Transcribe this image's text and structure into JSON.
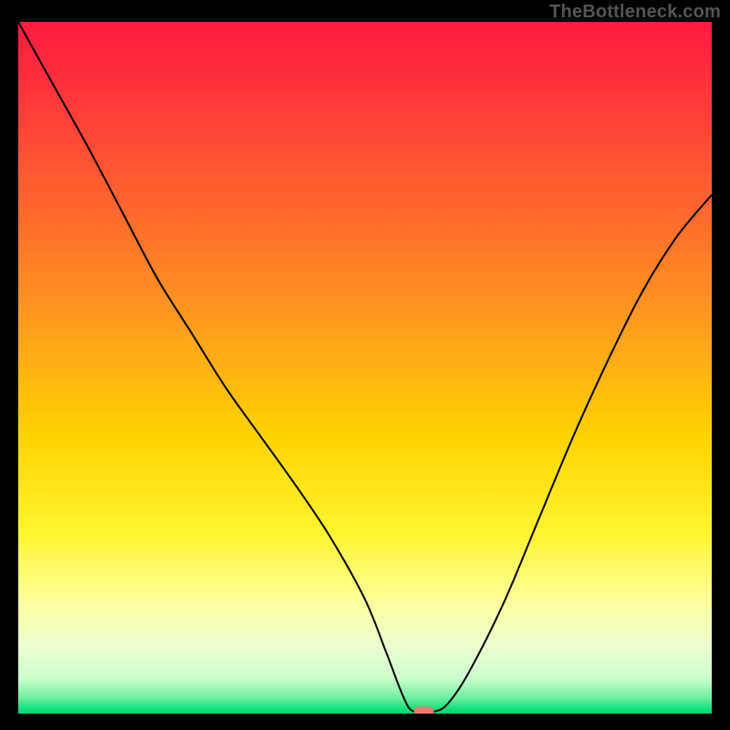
{
  "watermark": "TheBottleneck.com",
  "chart_data": {
    "type": "line",
    "title": "",
    "xlabel": "",
    "ylabel": "",
    "xlim": [
      0,
      100
    ],
    "ylim": [
      0,
      100
    ],
    "background_gradient": {
      "stops": [
        {
          "offset": 0.0,
          "color": "#ff1a40"
        },
        {
          "offset": 0.12,
          "color": "#ff3a3a"
        },
        {
          "offset": 0.28,
          "color": "#ff6a2d"
        },
        {
          "offset": 0.44,
          "color": "#ff9d1e"
        },
        {
          "offset": 0.6,
          "color": "#ffd400"
        },
        {
          "offset": 0.74,
          "color": "#fff531"
        },
        {
          "offset": 0.84,
          "color": "#fdff9e"
        },
        {
          "offset": 0.9,
          "color": "#eeffd0"
        },
        {
          "offset": 0.95,
          "color": "#caffce"
        },
        {
          "offset": 0.977,
          "color": "#6ef0a0"
        },
        {
          "offset": 0.992,
          "color": "#18e27e"
        },
        {
          "offset": 1.0,
          "color": "#00d873"
        }
      ]
    },
    "series": [
      {
        "name": "bottleneck-curve",
        "x": [
          0.0,
          5.0,
          10.0,
          15.0,
          20.0,
          25.0,
          30.0,
          35.0,
          40.0,
          45.0,
          50.0,
          53.0,
          55.5,
          57.0,
          60.0,
          62.0,
          65.0,
          70.0,
          75.0,
          80.0,
          85.0,
          90.0,
          95.0,
          100.0
        ],
        "y": [
          100.0,
          91.0,
          82.0,
          72.5,
          63.0,
          55.0,
          47.0,
          40.0,
          33.0,
          25.5,
          16.5,
          9.0,
          2.5,
          0.3,
          0.3,
          1.5,
          6.0,
          16.0,
          28.0,
          40.0,
          51.0,
          61.0,
          69.0,
          75.0
        ]
      }
    ],
    "marker": {
      "x": 58.5,
      "y": 0.3,
      "color": "#e97a6f"
    }
  }
}
